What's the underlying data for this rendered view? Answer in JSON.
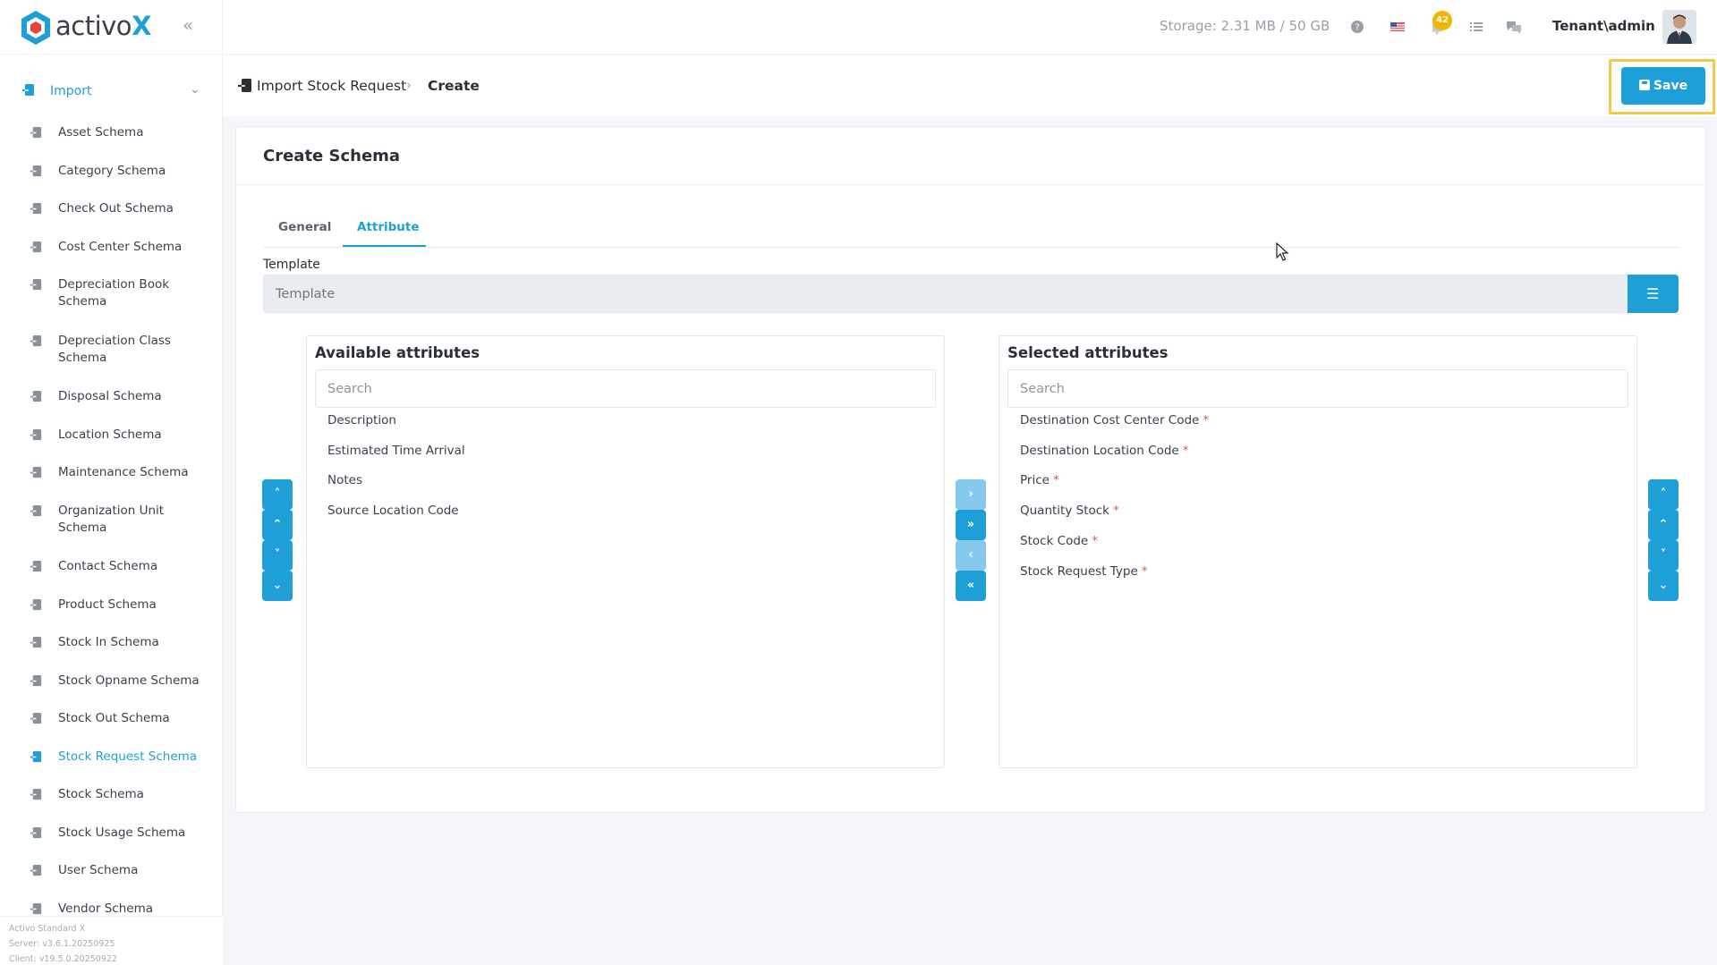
{
  "brand": {
    "name_part1": "activo",
    "name_part2": "X"
  },
  "sidebar": {
    "root_label": "Import",
    "items": [
      {
        "label": "Asset Schema"
      },
      {
        "label": "Category Schema"
      },
      {
        "label": "Check Out Schema"
      },
      {
        "label": "Cost Center Schema"
      },
      {
        "label": "Depreciation Book Schema"
      },
      {
        "label": "Depreciation Class Schema"
      },
      {
        "label": "Disposal Schema"
      },
      {
        "label": "Location Schema"
      },
      {
        "label": "Maintenance Schema"
      },
      {
        "label": "Organization Unit Schema"
      },
      {
        "label": "Contact Schema"
      },
      {
        "label": "Product Schema"
      },
      {
        "label": "Stock In Schema"
      },
      {
        "label": "Stock Opname Schema"
      },
      {
        "label": "Stock Out Schema"
      },
      {
        "label": "Stock Request Schema"
      },
      {
        "label": "Stock Schema"
      },
      {
        "label": "Stock Usage Schema"
      },
      {
        "label": "User Schema"
      },
      {
        "label": "Vendor Schema"
      }
    ],
    "active_item": "Stock Request Schema",
    "footer": {
      "edition": "Activo Standard X",
      "server": "Server: v3.6.1.20250925",
      "client": "Client: v19.5.0.20250922"
    }
  },
  "topbar": {
    "storage": "Storage: 2.31 MB / 50 GB",
    "notification_count": "42",
    "user": "Tenant\\admin"
  },
  "breadcrumb": {
    "parent": "Import Stock Request",
    "current": "Create"
  },
  "toolbar": {
    "save_label": "Save"
  },
  "form": {
    "title": "Create Schema",
    "tabs": [
      {
        "label": "General"
      },
      {
        "label": "Attribute",
        "active": true
      }
    ],
    "template_label": "Template",
    "template_placeholder": "Template"
  },
  "available": {
    "title": "Available attributes",
    "search_placeholder": "Search",
    "items": [
      "Description",
      "Estimated Time Arrival",
      "Notes",
      "Source Location Code"
    ]
  },
  "selected": {
    "title": "Selected attributes",
    "search_placeholder": "Search",
    "items": [
      "Destination Cost Center Code",
      "Destination Location Code",
      "Price",
      "Quantity Stock",
      "Stock Code",
      "Stock Request Type"
    ],
    "required_marker": "*"
  },
  "colors": {
    "accent": "#1e9fd8",
    "highlight_frame": "#f4c84a",
    "badge": "#f5b400",
    "required": "#e25555"
  }
}
